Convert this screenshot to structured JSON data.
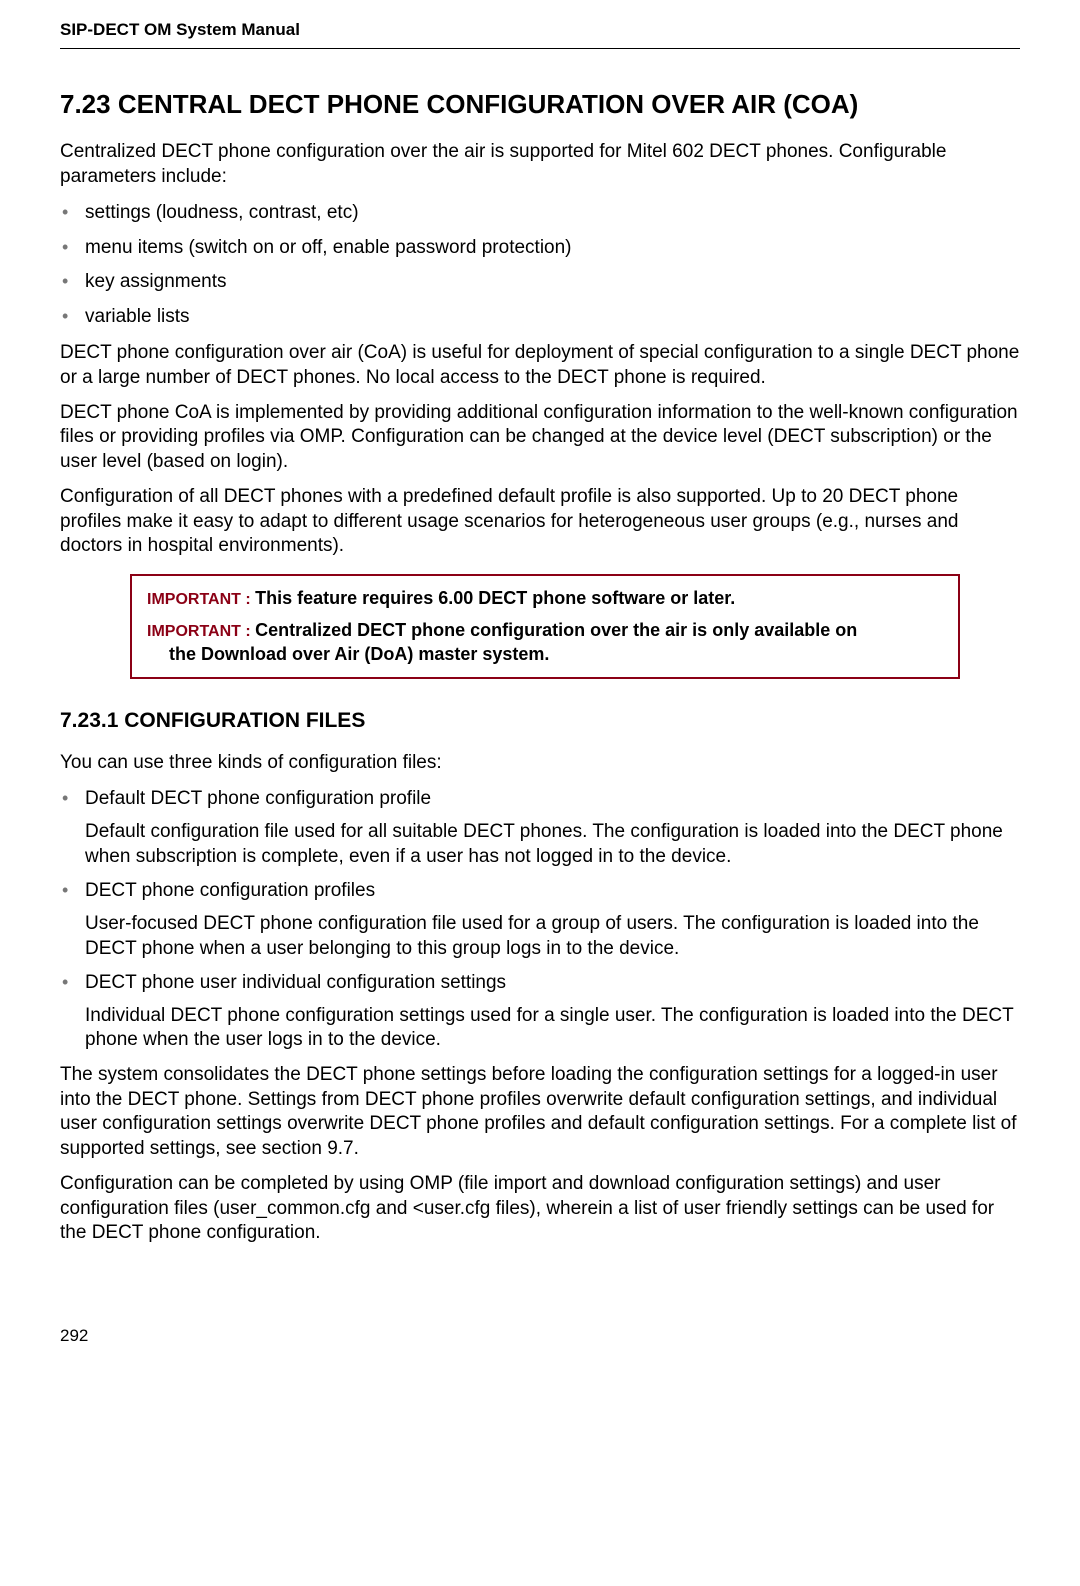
{
  "header": {
    "manual_title": "SIP-DECT OM System Manual"
  },
  "section": {
    "heading": "7.23 CENTRAL DECT PHONE CONFIGURATION OVER AIR (COA)",
    "intro": "Centralized DECT phone configuration over the air is supported for Mitel 602 DECT phones. Configurable parameters include:",
    "bullets": [
      "settings (loudness, contrast, etc)",
      "menu items (switch on or off, enable password protection)",
      "key assignments",
      "variable lists"
    ],
    "para1": "DECT phone configuration over air (CoA) is useful for deployment of special configuration to a single DECT phone or a large number of DECT phones. No local access to the DECT phone is required.",
    "para2": "DECT phone CoA is implemented by providing additional configuration information to the well-known configuration files or providing profiles via OMP. Configuration can be changed at the device level (DECT subscription) or the user level (based on login).",
    "para3": "Configuration of all DECT phones with a predefined default profile is also supported. Up to 20 DECT phone profiles make it easy to adapt to different usage scenarios for heterogeneous user groups (e.g., nurses and doctors in hospital environments)."
  },
  "important": {
    "label1": "IMPORTANT : ",
    "text1": "This feature requires 6.00 DECT phone software or later.",
    "label2": "IMPORTANT : ",
    "text2": "Centralized DECT phone configuration over the air is only available on",
    "text2b": "the Download over Air (DoA) master system."
  },
  "subsection": {
    "heading": "7.23.1 CONFIGURATION FILES",
    "intro": "You can use three kinds of configuration files:",
    "items": [
      {
        "title": "Default DECT phone configuration profile",
        "desc": "Default configuration file used for all suitable DECT phones. The configuration is loaded into the DECT phone when subscription is complete, even if a user has not logged in to the device."
      },
      {
        "title": "DECT phone configuration profiles",
        "desc": "User-focused DECT phone configuration file used for a group of users. The configuration is loaded into the DECT phone when a user belonging to this group logs in to the device."
      },
      {
        "title": "DECT phone user individual configuration settings",
        "desc": "Individual DECT phone configuration settings used for a single user. The configuration is loaded into the DECT phone when the user logs in to the device."
      }
    ],
    "para1": "The system consolidates the DECT phone settings before loading the configuration settings for a logged-in user into the DECT phone. Settings from DECT phone profiles overwrite default configuration settings, and individual user configuration settings overwrite DECT phone profiles and default configuration settings. For a complete list of supported settings, see section 9.7.",
    "para2": "Configuration can be completed by using OMP (file import and download configuration settings) and user configuration files (user_common.cfg and <user.cfg files), wherein a list of user friendly settings can be used for the DECT phone configuration."
  },
  "footer": {
    "page_number": "292"
  }
}
